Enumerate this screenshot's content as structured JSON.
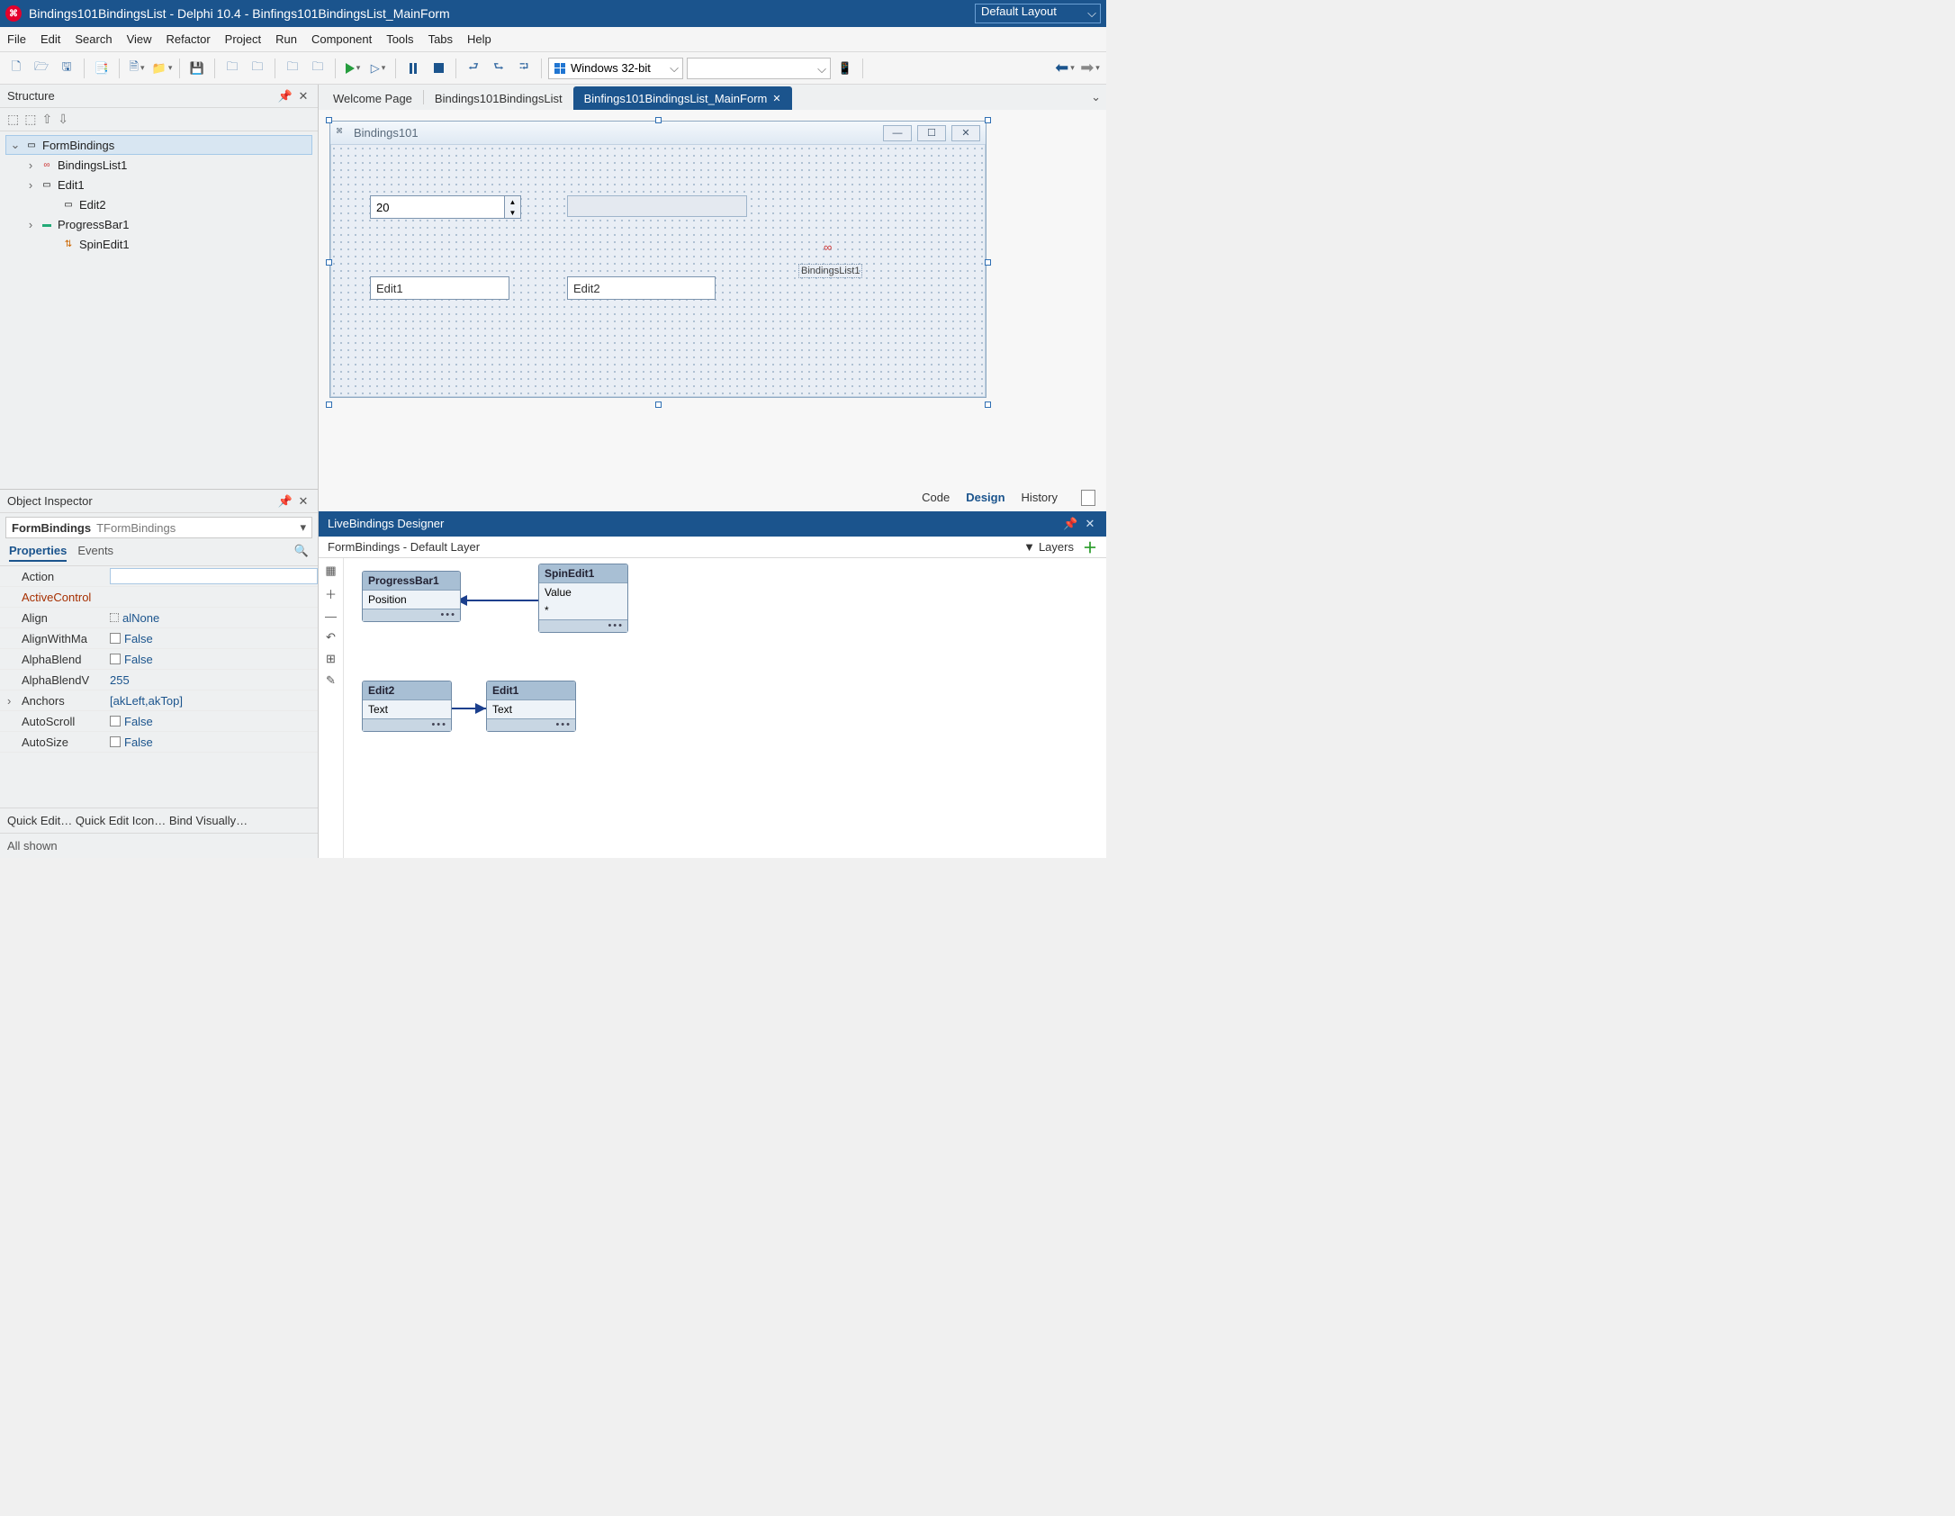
{
  "title": "Bindings101BindingsList - Delphi 10.4 - Binfings101BindingsList_MainForm",
  "layout_select": "Default Layout",
  "menu": [
    "File",
    "Edit",
    "Search",
    "View",
    "Refactor",
    "Project",
    "Run",
    "Component",
    "Tools",
    "Tabs",
    "Help"
  ],
  "target_platform": "Windows 32-bit",
  "tabs": [
    {
      "label": "Welcome Page",
      "active": false
    },
    {
      "label": "Bindings101BindingsList",
      "active": false
    },
    {
      "label": "Binfings101BindingsList_MainForm",
      "active": true
    }
  ],
  "structure": {
    "title": "Structure",
    "root": "FormBindings",
    "children": [
      {
        "label": "BindingsList1",
        "icon": "bind"
      },
      {
        "label": "Edit1",
        "icon": "edit"
      },
      {
        "label": "Edit2",
        "icon": "edit",
        "leaf": true
      },
      {
        "label": "ProgressBar1",
        "icon": "prog"
      },
      {
        "label": "SpinEdit1",
        "icon": "spin",
        "leaf": true
      }
    ]
  },
  "inspector": {
    "title": "Object Inspector",
    "sel_name": "FormBindings",
    "sel_type": "TFormBindings",
    "tabs": {
      "properties": "Properties",
      "events": "Events"
    },
    "rows": [
      {
        "name": "Action",
        "val": "",
        "edit": true
      },
      {
        "name": "ActiveControl",
        "val": "",
        "active": true
      },
      {
        "name": "Align",
        "val": "alNone",
        "icon": true
      },
      {
        "name": "AlignWithMargins",
        "short": "AlignWithMa",
        "val": "False",
        "chk": true
      },
      {
        "name": "AlphaBlend",
        "val": "False",
        "chk": true
      },
      {
        "name": "AlphaBlendValue",
        "short": "AlphaBlendV",
        "val": "255"
      },
      {
        "name": "Anchors",
        "val": "[akLeft,akTop]",
        "haschild": true
      },
      {
        "name": "AutoScroll",
        "val": "False",
        "chk": true
      },
      {
        "name": "AutoSize",
        "val": "False",
        "chk": true
      }
    ],
    "quick": "Quick Edit…  Quick Edit Icon…  Bind Visually…",
    "status": "All shown"
  },
  "form": {
    "title": "Bindings101",
    "spin_value": "20",
    "edit1": "Edit1",
    "edit2": "Edit2",
    "bindlabel": "BindingsList1"
  },
  "designer_tabs": {
    "code": "Code",
    "design": "Design",
    "history": "History"
  },
  "lb": {
    "title": "LiveBindings Designer",
    "subtitle": "FormBindings  - Default Layer",
    "layers": "Layers",
    "nodes": {
      "prog": {
        "title": "ProgressBar1",
        "field": "Position"
      },
      "spin": {
        "title": "SpinEdit1",
        "field": "Value",
        "extra": "*"
      },
      "edit2": {
        "title": "Edit2",
        "field": "Text"
      },
      "edit1": {
        "title": "Edit1",
        "field": "Text"
      }
    }
  }
}
